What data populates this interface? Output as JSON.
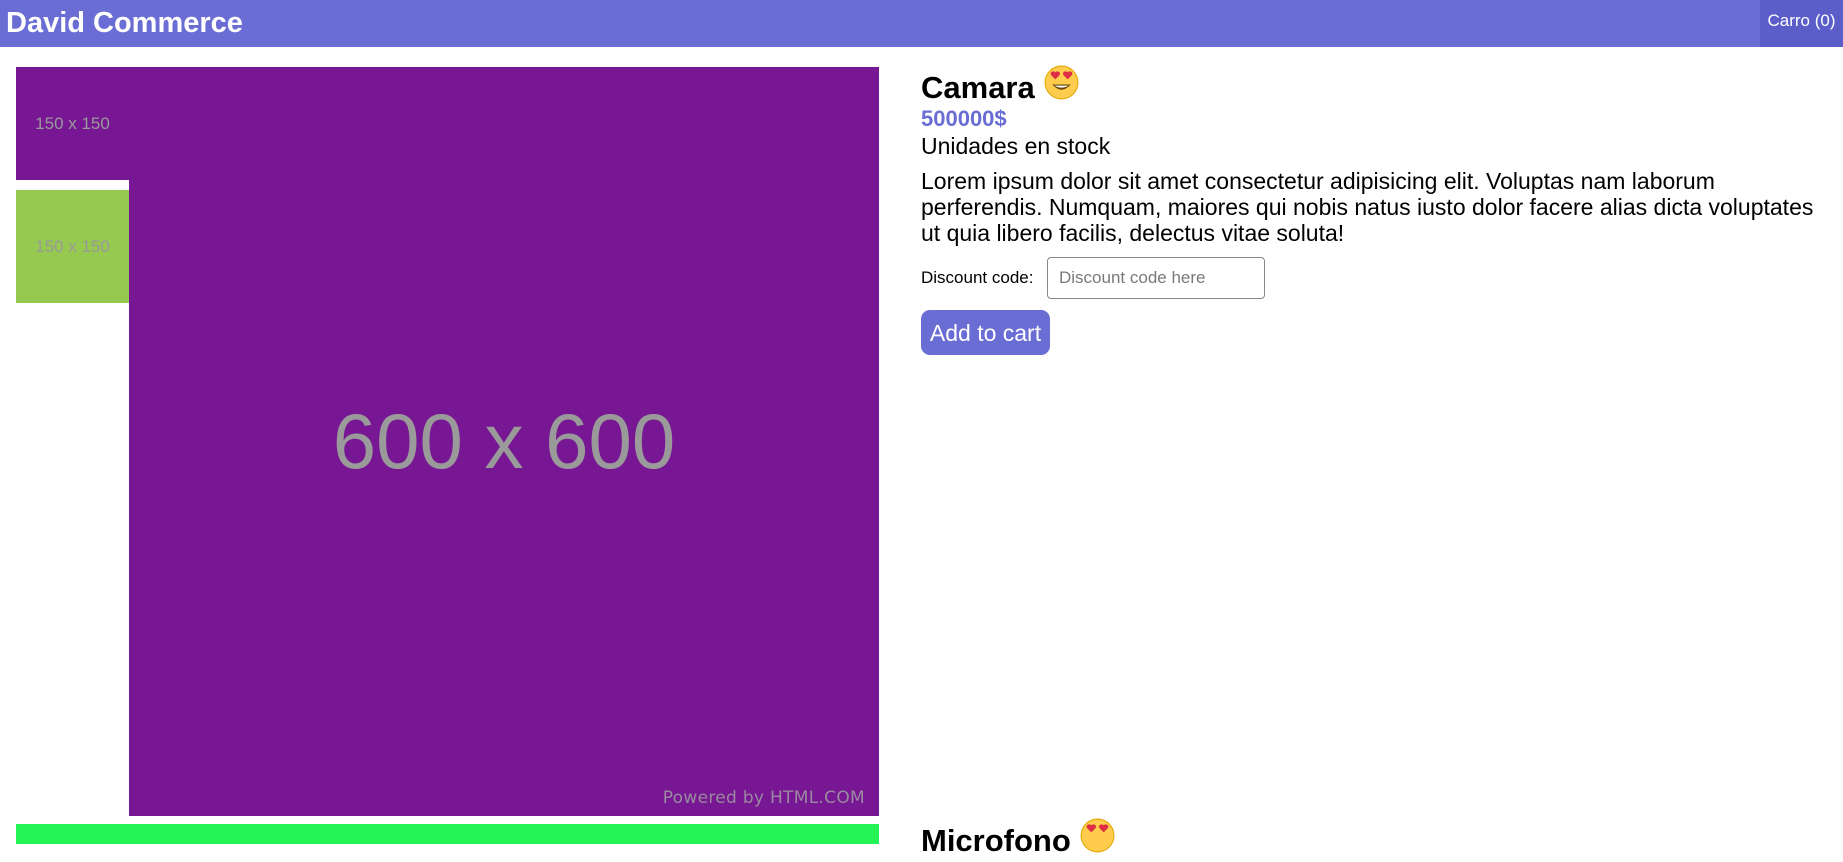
{
  "header": {
    "brand": "David Commerce",
    "cart_label": "Carro (0)",
    "background": "#6a6dd3"
  },
  "gallery": {
    "main_image_label": "600 x 600",
    "main_image_caption": "Powered by HTML.COM",
    "main_image_color": "#771793",
    "thumbnails": [
      {
        "label": "150 x 150",
        "color": "#771793"
      },
      {
        "label": "150 x 150",
        "color": "#95c94f"
      }
    ],
    "next_image_color": "#24f255"
  },
  "product": {
    "title": "Camara",
    "title_icon": "heart-eyes-emoji",
    "price": "500000$",
    "stock": "Unidades en stock",
    "description": "Lorem ipsum dolor sit amet consectetur adipisicing elit. Voluptas nam laborum perferendis. Numquam, maiores qui nobis natus iusto dolor facere alias dicta voluptates ut quia libero facilis, delectus vitae soluta!",
    "discount_label": "Discount code:",
    "discount_placeholder": "Discount code here",
    "add_to_cart_label": "Add to cart",
    "accent": "#6a6dd3"
  },
  "next_product": {
    "title": "Microfono",
    "title_icon": "heart-eyes-emoji"
  }
}
